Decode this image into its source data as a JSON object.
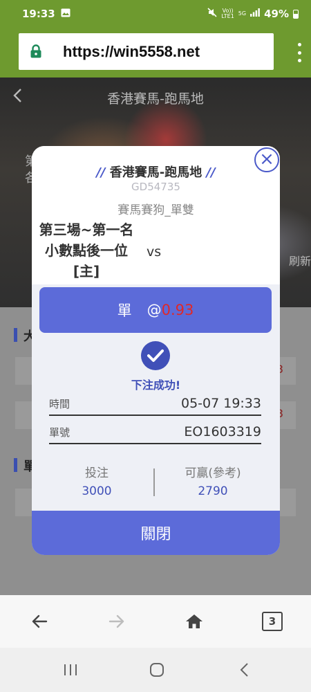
{
  "status_bar": {
    "time": "19:33",
    "network_top": "Vo))",
    "network_bottom": "LTE1",
    "net_5g": "5G",
    "battery": "49%"
  },
  "browser": {
    "url": "https://win5558.net"
  },
  "background_page": {
    "title": "香港賽馬-跑馬地",
    "side_text": "第各",
    "refresh": "刷新",
    "ghost_a": "大",
    "ghost_b": "單",
    "ghost_red": "3"
  },
  "modal": {
    "slashes": "//",
    "title": "香港賽馬-跑馬地",
    "code": "GD54735",
    "bet_type": "賽馬賽狗_單雙",
    "match_name": "第三場~第一名小數點後一位[主]",
    "vs": "vs",
    "close_x": "×",
    "selection": "單",
    "odds_prefix": "@",
    "odds": "0.93",
    "success": "下注成功!",
    "rows": [
      {
        "label": "時間",
        "value": "05-07 19:33"
      },
      {
        "label": "單號",
        "value": "EO1603319"
      }
    ],
    "stake_label": "投注",
    "stake": "3000",
    "win_label": "可贏(參考)",
    "win": "2790",
    "close_label": "關閉"
  },
  "toolbar": {
    "tab_count": "3"
  },
  "icons": {
    "status": [
      "gallery-icon",
      "mute-icon",
      "signal-icon",
      "battery-icon"
    ],
    "browser": [
      "lock-icon",
      "menu-dots-icon"
    ],
    "toolbar": [
      "back-arrow-icon",
      "forward-arrow-icon",
      "home-icon",
      "tabs-icon"
    ],
    "nav": [
      "recents-icon",
      "home-circle-icon",
      "nav-back-icon"
    ]
  },
  "colors": {
    "browser_green": "#6e9a2f",
    "accent_blue": "#5c6bd9",
    "odds_red": "#e02828"
  }
}
